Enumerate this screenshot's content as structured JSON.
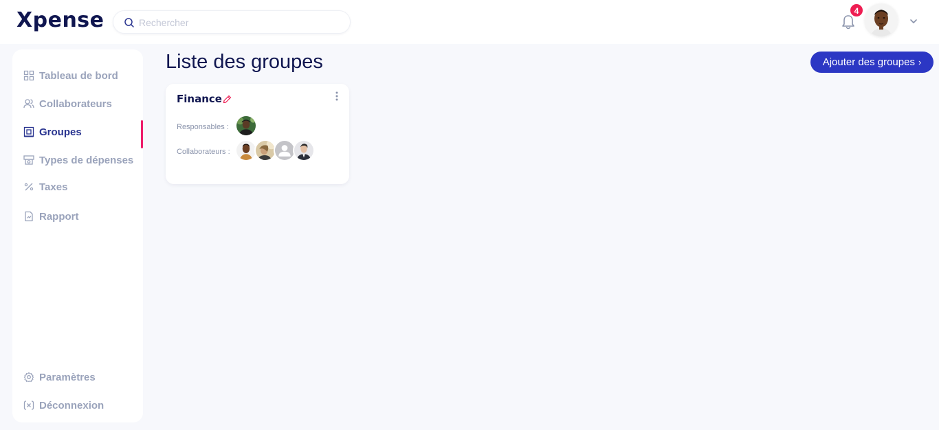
{
  "header": {
    "logo": "Xpense",
    "search_placeholder": "Rechercher",
    "notifications_count": "4"
  },
  "sidebar": {
    "items": [
      {
        "label": "Tableau de bord",
        "icon": "dashboard-icon"
      },
      {
        "label": "Collaborateurs",
        "icon": "users-icon"
      },
      {
        "label": "Groupes",
        "icon": "groups-icon",
        "active": true
      },
      {
        "label": "Types de dépenses",
        "icon": "expense-types-icon"
      },
      {
        "label": "Taxes",
        "icon": "percent-icon"
      },
      {
        "label": "Rapport",
        "icon": "report-icon"
      }
    ],
    "bottom_items": [
      {
        "label": "Paramètres",
        "icon": "gear-icon"
      },
      {
        "label": "Déconnexion",
        "icon": "logout-icon"
      }
    ]
  },
  "main": {
    "title": "Liste des groupes",
    "add_button": "Ajouter des groupes",
    "groups": [
      {
        "name": "Finance",
        "responsables_label": "Responsables :",
        "collaborateurs_label": "Collaborateurs :"
      }
    ]
  },
  "colors": {
    "brand": "#101650",
    "accent": "#2c37c4",
    "highlight": "#ee1d52"
  }
}
